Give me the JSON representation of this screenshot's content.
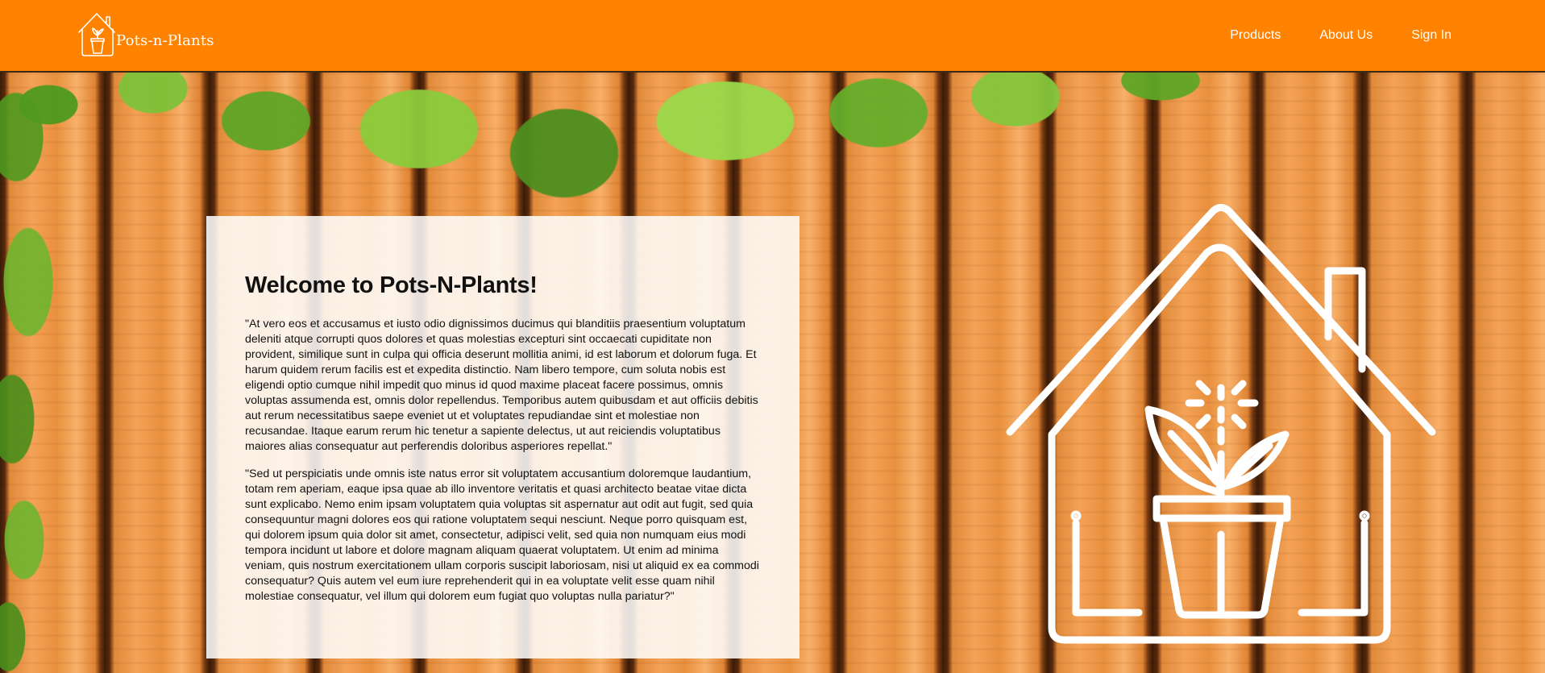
{
  "header": {
    "brand": "Pots-n-Plants",
    "nav": [
      {
        "label": "Products"
      },
      {
        "label": "About Us"
      },
      {
        "label": "Sign In"
      }
    ],
    "background_color": "#ff8300"
  },
  "hero": {
    "background_icon": "house-plant-icon",
    "card": {
      "title": "Welcome to Pots-N-Plants!",
      "paragraphs": [
        "\"At vero eos et accusamus et iusto odio dignissimos ducimus qui blanditiis praesentium voluptatum deleniti atque corrupti quos dolores et quas molestias excepturi sint occaecati cupiditate non provident, similique sunt in culpa qui officia deserunt mollitia animi, id est laborum et dolorum fuga. Et harum quidem rerum facilis est et expedita distinctio. Nam libero tempore, cum soluta nobis est eligendi optio cumque nihil impedit quo minus id quod maxime placeat facere possimus, omnis voluptas assumenda est, omnis dolor repellendus. Temporibus autem quibusdam et aut officiis debitis aut rerum necessitatibus saepe eveniet ut et voluptates repudiandae sint et molestiae non recusandae. Itaque earum rerum hic tenetur a sapiente delectus, ut aut reiciendis voluptatibus maiores alias consequatur aut perferendis doloribus asperiores repellat.\"",
        "\"Sed ut perspiciatis unde omnis iste natus error sit voluptatem accusantium doloremque laudantium, totam rem aperiam, eaque ipsa quae ab illo inventore veritatis et quasi architecto beatae vitae dicta sunt explicabo. Nemo enim ipsam voluptatem quia voluptas sit aspernatur aut odit aut fugit, sed quia consequuntur magni dolores eos qui ratione voluptatem sequi nesciunt. Neque porro quisquam est, qui dolorem ipsum quia dolor sit amet, consectetur, adipisci velit, sed quia non numquam eius modi tempora incidunt ut labore et dolore magnam aliquam quaerat voluptatem. Ut enim ad minima veniam, quis nostrum exercitationem ullam corporis suscipit laboriosam, nisi ut aliquid ex ea commodi consequatur? Quis autem vel eum iure reprehenderit qui in ea voluptate velit esse quam nihil molestiae consequatur, vel illum qui dolorem eum fugiat quo voluptas nulla pariatur?\""
      ]
    }
  }
}
